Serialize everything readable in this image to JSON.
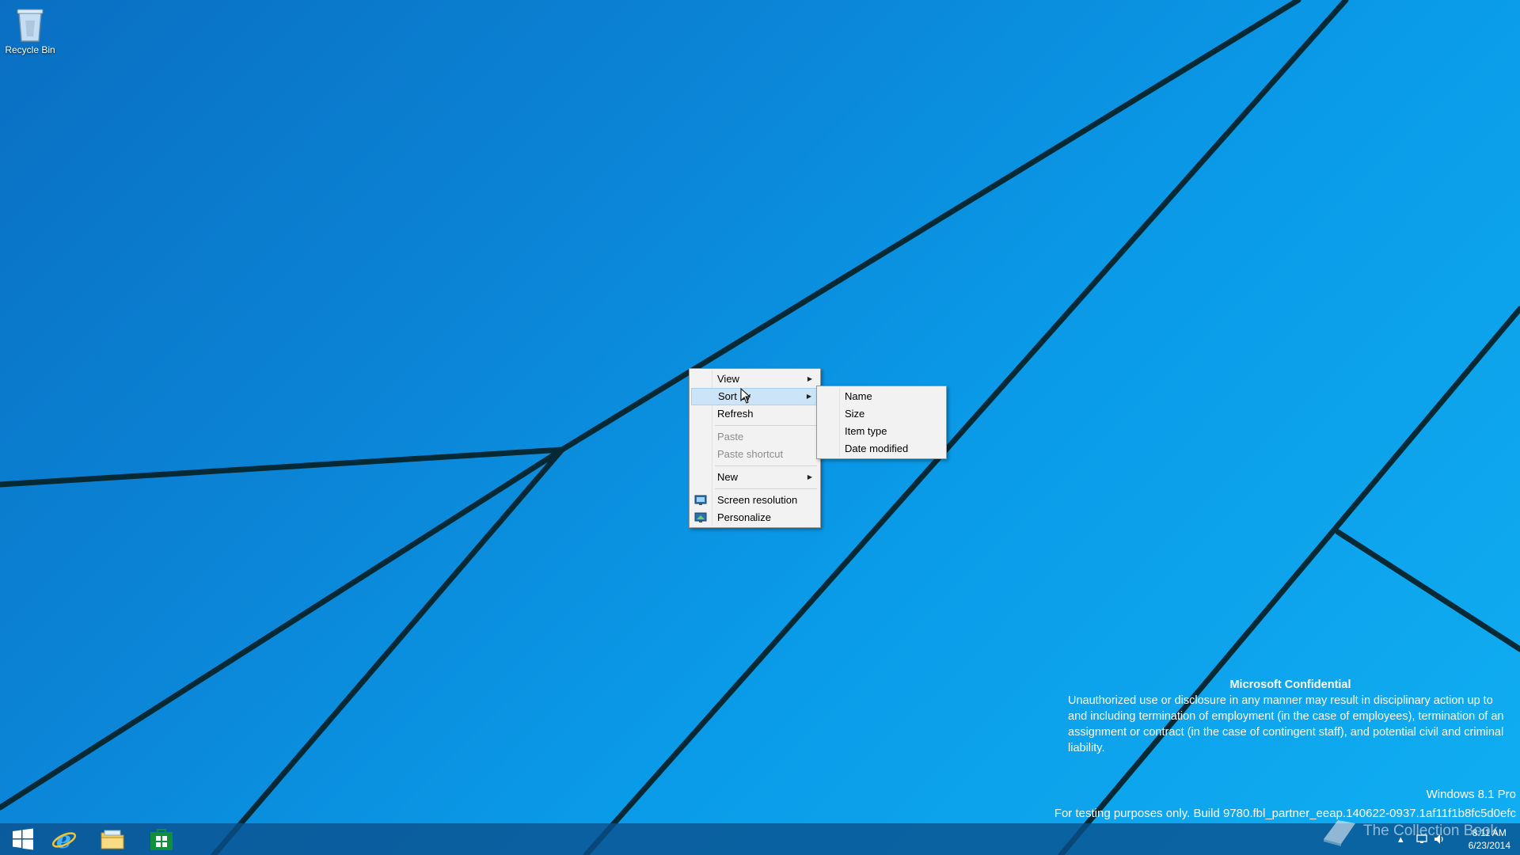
{
  "desktop": {
    "icons": [
      {
        "label": "Recycle Bin",
        "icon": "recycle-bin-icon"
      }
    ]
  },
  "context_menu": {
    "items": [
      {
        "label": "View",
        "submenu": true
      },
      {
        "label": "Sort by",
        "submenu": true,
        "highlighted": true
      },
      {
        "label": "Refresh"
      },
      {
        "label": "Paste",
        "disabled": true
      },
      {
        "label": "Paste shortcut",
        "disabled": true
      },
      {
        "label": "New",
        "submenu": true
      },
      {
        "label": "Screen resolution",
        "icon": "screen-resolution-icon"
      },
      {
        "label": "Personalize",
        "icon": "personalize-icon"
      }
    ]
  },
  "sort_submenu": {
    "items": [
      {
        "label": "Name"
      },
      {
        "label": "Size"
      },
      {
        "label": "Item type"
      },
      {
        "label": "Date modified"
      }
    ]
  },
  "watermark": {
    "title": "Microsoft Confidential",
    "body": "Unauthorized use or disclosure in any manner may result in disciplinary action up to and including termination of employment (in the case of employees), termination of an assignment or contract (in the case of contingent staff), and potential civil and criminal liability.",
    "edition": "Windows 8.1 Pro",
    "build": "For testing purposes only. Build 9780.fbl_partner_eeap.140622-0937.1af11f1b8fc5d0efc",
    "site_logo_text": "The Collection Book"
  },
  "taskbar": {
    "buttons": [
      {
        "name": "start-button",
        "icon": "windows-logo-icon"
      },
      {
        "name": "internet-explorer-button",
        "icon": "internet-explorer-icon"
      },
      {
        "name": "file-explorer-button",
        "icon": "folder-icon"
      },
      {
        "name": "store-button",
        "icon": "store-icon"
      }
    ],
    "clock": {
      "time": "8:11 AM",
      "date": "6/23/2014"
    }
  },
  "colors": {
    "highlight": "#cce4f7",
    "menu_bg": "#f2f2f2",
    "taskbar": "#0a508c"
  }
}
